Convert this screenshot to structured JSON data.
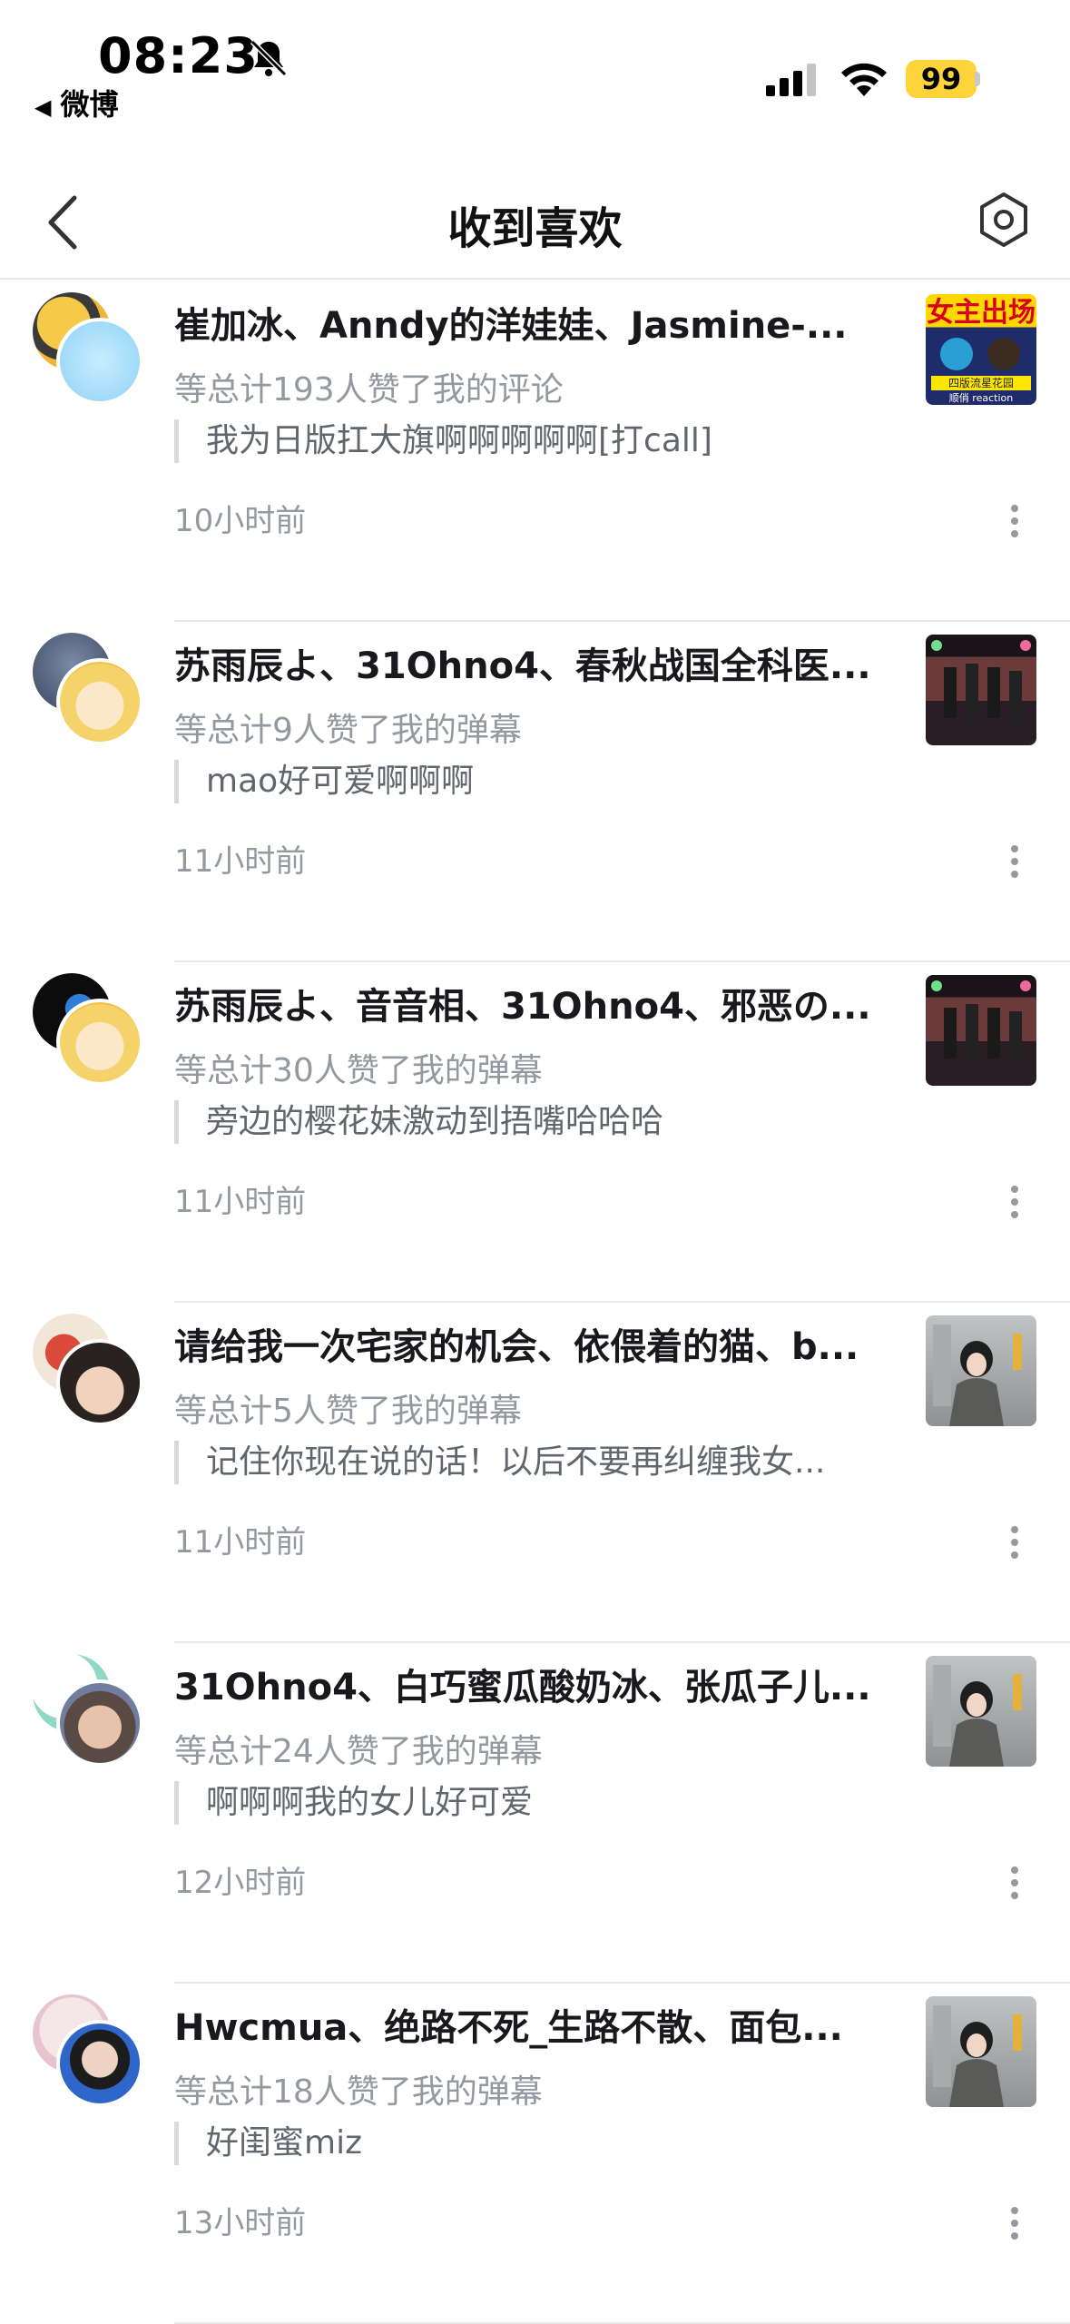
{
  "status_bar": {
    "time": "08:23",
    "back_app_label": "微博",
    "battery": "99"
  },
  "header": {
    "title": "收到喜欢"
  },
  "items": [
    {
      "names": "崔加冰、Anndy的洋娃娃、Jasmine-...",
      "summary": "等总计193人赞了我的评论",
      "quote": "我为日版扛大旗啊啊啊啊啊[打call]",
      "time_ago": "10小时前",
      "thumb_texts": [
        "女主出场",
        "四版流星花园",
        "顺俏 reaction"
      ]
    },
    {
      "names": "苏雨辰よ、31Ohno4、春秋战国全科医...",
      "summary": "等总计9人赞了我的弹幕",
      "quote": "mao好可爱啊啊啊",
      "time_ago": "11小时前"
    },
    {
      "names": "苏雨辰よ、音音相、31Ohno4、邪恶の...",
      "summary": "等总计30人赞了我的弹幕",
      "quote": "旁边的樱花妹激动到捂嘴哈哈哈",
      "time_ago": "11小时前"
    },
    {
      "names": "请给我一次宅家的机会、依偎着的猫、b...",
      "summary": "等总计5人赞了我的弹幕",
      "quote": "记住你现在说的话！以后不要再纠缠我女...",
      "time_ago": "11小时前"
    },
    {
      "names": "31Ohno4、白巧蜜瓜酸奶冰、张瓜子儿...",
      "summary": "等总计24人赞了我的弹幕",
      "quote": "啊啊啊我的女儿好可爱",
      "time_ago": "12小时前"
    },
    {
      "names": "Hwcmua、绝路不死_生路不散、面包...",
      "summary": "等总计18人赞了我的弹幕",
      "quote": "好闺蜜miz",
      "time_ago": "13小时前"
    }
  ],
  "colors": {
    "battery": "#ffd43a",
    "secondary_text": "#9499a0",
    "quote_text": "#61666d"
  },
  "icons": [
    "bell-off-icon",
    "signal-icon",
    "wifi-icon",
    "back-arrow-icon",
    "settings-icon",
    "more-icon"
  ]
}
